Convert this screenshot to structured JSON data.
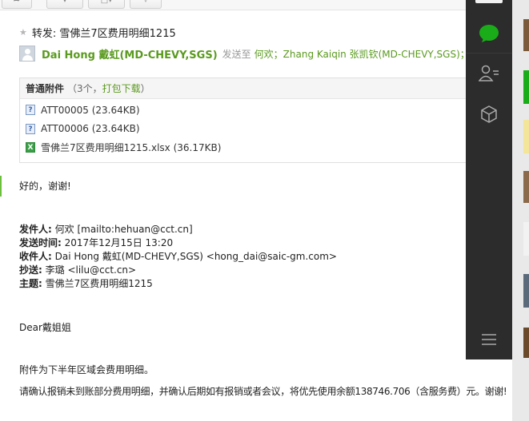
{
  "toolbar": {
    "icons": [
      "forward-icon",
      "more-icon",
      "mark-icon",
      "move-icon"
    ]
  },
  "email": {
    "subject": "转发: 雪佛兰7区费用明细1215",
    "sender_name": "Dai Hong 戴虹(MD-CHEVY,SGS)",
    "sent_to_label": "发送至",
    "recipients": "何欢；Zhang Kaiqin 张凯钦(MD-CHEVY,SGS)；"
  },
  "attachments": {
    "title": "普通附件",
    "count_prefix": "（3个，",
    "download_all": "打包下载",
    "count_suffix": "）",
    "items": [
      {
        "icon": "unknown-file-icon",
        "label": "ATT00005 (23.64KB)"
      },
      {
        "icon": "unknown-file-icon",
        "label": "ATT00006 (23.64KB)"
      },
      {
        "icon": "excel-file-icon",
        "label": "雪佛兰7区费用明细1215.xlsx (36.17KB)"
      }
    ]
  },
  "body": {
    "reply": "好的，谢谢!",
    "fwd": {
      "from_label": "发件人:",
      "from_value": "何欢 [mailto:hehuan@cct.cn]",
      "sent_label": "发送时间:",
      "sent_value": "2017年12月15日 13:20",
      "to_label": "收件人:",
      "to_value": "Dai Hong 戴虹(MD-CHEVY,SGS) <hong_dai@saic-gm.com>",
      "cc_label": "抄送:",
      "cc_value": "李璐 <lilu@cct.cn>",
      "subj_label": "主题:",
      "subj_value": "雪佛兰7区费用明细1215"
    },
    "greeting": "Dear戴姐姐",
    "line1": "附件为下半年区域会费用明细。",
    "line2": "请确认报销未到账部分费用明细，并确认后期如有报销或者会议，将优先使用余额138746.706（含服务费）元。谢谢!"
  },
  "sidebar": {
    "icons": [
      "chat-icon",
      "contacts-icon",
      "apps-box-icon",
      "menu-icon"
    ],
    "accent": "#1aad19"
  },
  "colors": {
    "link_green": "#5a9a1e",
    "sidebar_bg": "#2c2c2c"
  }
}
